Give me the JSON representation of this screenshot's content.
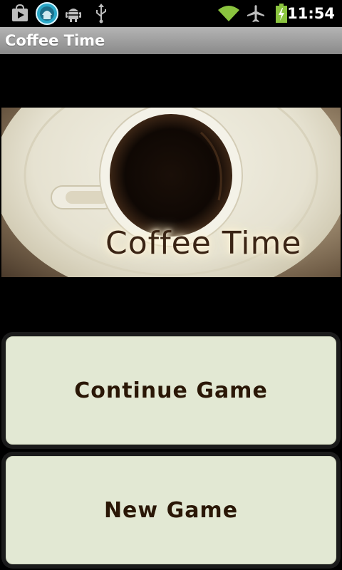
{
  "status_bar": {
    "icons": [
      "play-store-icon",
      "app-notification-icon",
      "android-debug-icon",
      "usb-icon",
      "wifi-icon",
      "airplane-icon",
      "battery-icon"
    ],
    "time": "11:54",
    "colors": {
      "wifi": "#8bc43f",
      "battery": "#8bc43f",
      "icon": "#bdbdbd"
    }
  },
  "title_bar": {
    "title": "Coffee Time"
  },
  "banner": {
    "text": "Coffee Time",
    "image": "coffee-cup-top-view"
  },
  "menu": {
    "continue_label": "Continue Game",
    "new_label": "New Game"
  },
  "colors": {
    "button_bg": "#e2e8d3",
    "button_text": "#2a1706"
  }
}
